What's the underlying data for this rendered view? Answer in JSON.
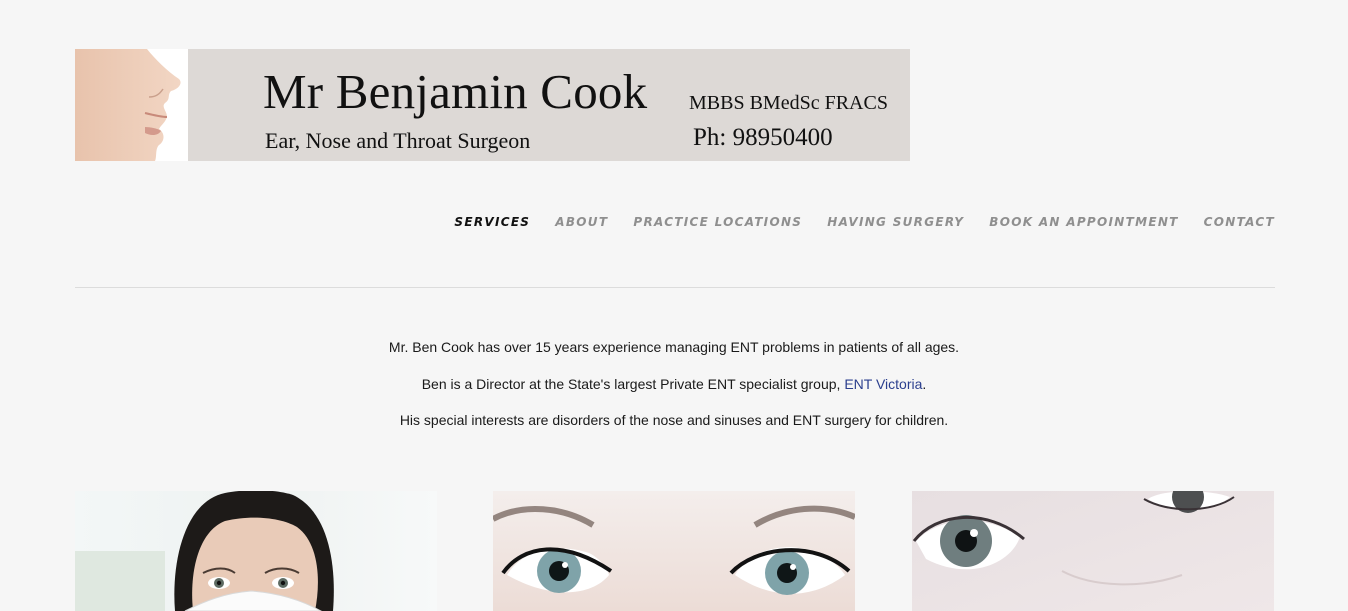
{
  "banner": {
    "name": "Mr Benjamin Cook",
    "qualifications": "MBBS BMedSc FRACS",
    "role": "Ear, Nose and Throat Surgeon",
    "phone": "Ph: 98950400"
  },
  "nav": {
    "items": [
      {
        "label": "SERVICES",
        "active": true
      },
      {
        "label": "ABOUT",
        "active": false
      },
      {
        "label": "PRACTICE LOCATIONS",
        "active": false
      },
      {
        "label": "HAVING SURGERY",
        "active": false
      },
      {
        "label": "BOOK AN APPOINTMENT",
        "active": false
      },
      {
        "label": "CONTACT",
        "active": false
      }
    ]
  },
  "intro": {
    "line1": "Mr. Ben Cook has over 15 years experience managing ENT problems in patients of all ages.",
    "line2_prefix": "Ben is a Director at the State's largest Private ENT specialist group, ",
    "line2_link": "ENT Victoria",
    "line2_suffix": ".",
    "line3": "His special interests are disorders of the nose and sinuses and ENT surgery for children."
  },
  "colors": {
    "background": "#f6f6f6",
    "banner": "#ddd9d6",
    "nav_active": "#111111",
    "nav_inactive": "#8f8f8f",
    "link": "#2b3f8e"
  },
  "icons": [
    "face-profile-photo",
    "face-mask-photo",
    "eyes-photo",
    "child-eyes-photo"
  ]
}
